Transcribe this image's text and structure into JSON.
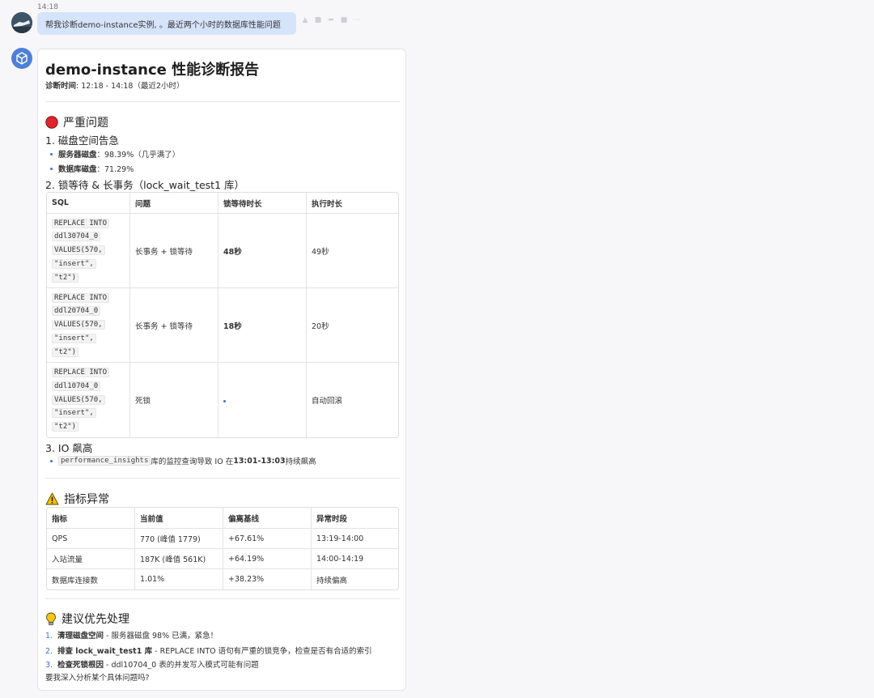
{
  "chat": {
    "time": "14:18",
    "user_message": "帮我诊断demo-instance实例, 。最近两个小时的数据库性能问题"
  },
  "report": {
    "title": "demo-instance 性能诊断报告",
    "diag_label": "诊断时间",
    "diag_value": ":  12:18 - 14:18（最近2小时）",
    "critical": {
      "heading": "严重问题",
      "disk": {
        "title": "1. 磁盘空间告急",
        "server_label": "服务器磁盘",
        "server_value": "：98.39%（几乎满了）",
        "db_label": "数据库磁盘",
        "db_value": "：71.29%"
      },
      "locks": {
        "title": "2. 锁等待 & 长事务（lock_wait_test1 库）",
        "headers": [
          "SQL",
          "问题",
          "锁等待时长",
          "执行时长"
        ],
        "rows": [
          {
            "sql": [
              "REPLACE INTO",
              "ddl30704_0",
              "VALUES(570,",
              "\"insert\",",
              "\"t2\")"
            ],
            "issue": "长事务 + 锁等待",
            "wait": "48秒",
            "exec": "49秒"
          },
          {
            "sql": [
              "REPLACE INTO",
              "ddl20704_0",
              "VALUES(570,",
              "\"insert\",",
              "\"t2\")"
            ],
            "issue": "长事务 + 锁等待",
            "wait": "18秒",
            "exec": "20秒"
          },
          {
            "sql": [
              "REPLACE INTO",
              "ddl10704_0",
              "VALUES(570,",
              "\"insert\",",
              "\"t2\")"
            ],
            "issue": "死锁",
            "wait": "",
            "exec": "自动回滚"
          }
        ]
      },
      "io": {
        "title": "3. IO 飙高",
        "code": "performance_insights",
        "text_before": " 库的监控查询导致 IO 在 ",
        "time_range": "13:01-13:03",
        "text_after": " 持续飙高"
      }
    },
    "metrics": {
      "heading": "指标异常",
      "headers": [
        "指标",
        "当前值",
        "偏离基线",
        "异常时段"
      ],
      "rows": [
        {
          "name": "QPS",
          "current": "770 (峰值 1779)",
          "deviation": "+67.61%",
          "period": "13:19-14:00"
        },
        {
          "name": "入站流量",
          "current": "187K (峰值 561K)",
          "deviation": "+64.19%",
          "period": "14:00-14:19"
        },
        {
          "name": "数据库连接数",
          "current": "1.01%",
          "deviation": "+38.23%",
          "period": "持续偏高"
        }
      ]
    },
    "suggestions": {
      "heading": "建议优先处理",
      "items": [
        {
          "num": "1.",
          "bold": "清理磁盘空间",
          "text": " - 服务器磁盘 98% 已满，紧急！"
        },
        {
          "num": "2.",
          "bold": "排查 lock_wait_test1 库",
          "text": " - REPLACE INTO 语句有严重的锁竞争，检查是否有合适的索引"
        },
        {
          "num": "3.",
          "bold": "检查死锁根因",
          "text": " - ddl10704_0 表的并发写入模式可能有问题"
        }
      ],
      "closing": "要我深入分析某个具体问题吗?"
    }
  },
  "colors": {
    "accent": "#3d6fd8",
    "bubble": "#d6e4fb",
    "critical_icon": "#e0242b",
    "warning_icon": "#f2c200"
  }
}
